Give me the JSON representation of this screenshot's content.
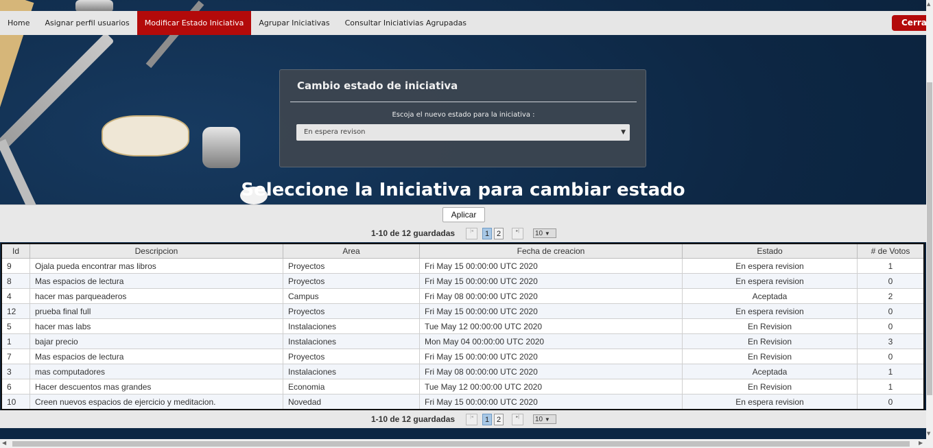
{
  "nav": {
    "items": [
      {
        "label": "Home",
        "active": false
      },
      {
        "label": "Asignar perfil usuarios",
        "active": false
      },
      {
        "label": "Modificar Estado Iniciativa",
        "active": true
      },
      {
        "label": "Agrupar Iniciativas",
        "active": false
      },
      {
        "label": "Consultar Iniciativias Agrupadas",
        "active": false
      }
    ],
    "logout_label": "Cerrar"
  },
  "panel": {
    "title": "Cambio estado de iniciativa",
    "label": "Escoja el nuevo estado para la iniciativa :",
    "select_value": "En espera revison"
  },
  "heading": "Seleccione la Iniciativa para cambiar estado",
  "apply_label": "Aplicar",
  "pager": {
    "summary": "1-10 de 12 guardadas",
    "pages": [
      "1",
      "2"
    ],
    "current_page": "1",
    "page_size": "10"
  },
  "table": {
    "columns": [
      "Id",
      "Descripcion",
      "Area",
      "Fecha de creacion",
      "Estado",
      "# de Votos"
    ],
    "rows": [
      [
        "9",
        "Ojala pueda encontrar mas libros",
        "Proyectos",
        "Fri May 15 00:00:00 UTC 2020",
        "En espera revision",
        "1"
      ],
      [
        "8",
        "Mas espacios de lectura",
        "Proyectos",
        "Fri May 15 00:00:00 UTC 2020",
        "En espera revision",
        "0"
      ],
      [
        "4",
        "hacer mas parqueaderos",
        "Campus",
        "Fri May 08 00:00:00 UTC 2020",
        "Aceptada",
        "2"
      ],
      [
        "12",
        "prueba final full",
        "Proyectos",
        "Fri May 15 00:00:00 UTC 2020",
        "En espera revision",
        "0"
      ],
      [
        "5",
        "hacer mas labs",
        "Instalaciones",
        "Tue May 12 00:00:00 UTC 2020",
        "En Revision",
        "0"
      ],
      [
        "1",
        "bajar precio",
        "Instalaciones",
        "Mon May 04 00:00:00 UTC 2020",
        "En Revision",
        "3"
      ],
      [
        "7",
        "Mas espacios de lectura",
        "Proyectos",
        "Fri May 15 00:00:00 UTC 2020",
        "En Revision",
        "0"
      ],
      [
        "3",
        "mas computadores",
        "Instalaciones",
        "Fri May 08 00:00:00 UTC 2020",
        "Aceptada",
        "1"
      ],
      [
        "6",
        "Hacer descuentos mas grandes",
        "Economia",
        "Tue May 12 00:00:00 UTC 2020",
        "En Revision",
        "1"
      ],
      [
        "10",
        "Creen nuevos espacios de ejercicio y meditacion.",
        "Novedad",
        "Fri May 15 00:00:00 UTC 2020",
        "En espera revision",
        "0"
      ]
    ]
  }
}
